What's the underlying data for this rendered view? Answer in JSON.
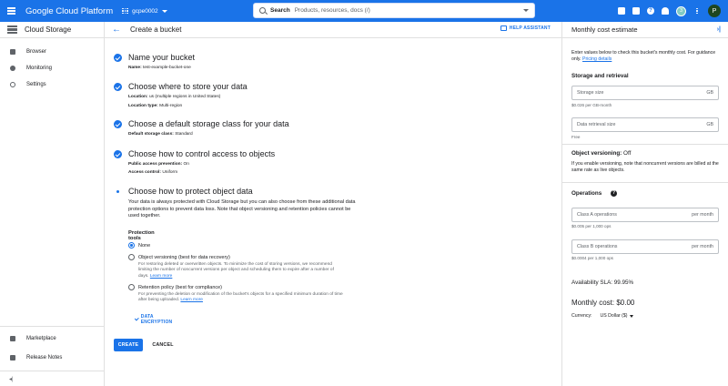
{
  "topbar": {
    "brand": "Google Cloud Platform",
    "project": "gcpe0002",
    "search_label": "Search",
    "search_placeholder": "Products, resources, docs (/)",
    "badge": "3",
    "avatar": "P",
    "bg_color": "#1a73e8"
  },
  "sidebar": {
    "title": "Cloud Storage",
    "items": [
      {
        "label": "Browser",
        "icon": "bucket-icon"
      },
      {
        "label": "Monitoring",
        "icon": "monitoring-icon"
      },
      {
        "label": "Settings",
        "icon": "gear-icon"
      }
    ],
    "bottom_items": [
      {
        "label": "Marketplace",
        "icon": "marketplace-icon"
      },
      {
        "label": "Release Notes",
        "icon": "notes-icon"
      }
    ],
    "collapse": "◂|"
  },
  "main": {
    "title": "Create a bucket",
    "help": "HELP ASSISTANT",
    "steps": {
      "name": {
        "title": "Name your bucket",
        "k1": "Name:",
        "v1": "test-example-bucket-one"
      },
      "location": {
        "title": "Choose where to store your data",
        "k1": "Location:",
        "v1": "us (multiple regions in United States)",
        "k2": "Location type:",
        "v2": "Multi-region"
      },
      "storage": {
        "title": "Choose a default storage class for your data",
        "k1": "Default storage class:",
        "v1": "Standard"
      },
      "access": {
        "title": "Choose how to control access to objects",
        "k1": "Public access prevention:",
        "v1": "On",
        "k2": "Access control:",
        "v2": "Uniform"
      },
      "protect": {
        "title": "Choose how to protect object data",
        "desc": "Your data is always protected with Cloud Storage but you can also choose from these additional data protection options to prevent data loss. Note that object versioning and retention policies cannot be used together.",
        "tools_title": "Protection tools",
        "opt_none": "None",
        "opt_versioning": "Object versioning (best for data recovery)",
        "opt_versioning_desc": "For restoring deleted or overwritten objects. To minimize the cost of storing versions, we recommend limiting the number of noncurrent versions per object and scheduling them to expire after a number of days.",
        "opt_retention": "Retention policy (best for compliance)",
        "opt_retention_desc": "For preventing the deletion or modification of the bucket's objects for a specified minimum duration of time after being uploaded.",
        "learn_more": "Learn more",
        "encryption": "DATA ENCRYPTION"
      }
    },
    "create": "CREATE",
    "cancel": "CANCEL"
  },
  "cost_panel": {
    "title": "Monthly cost estimate",
    "intro": "Enter values below to check this bucket's monthly cost. For guidance only.",
    "pricing": "Pricing details",
    "storage_title": "Storage and retrieval",
    "storage_size": {
      "label": "Storage size",
      "unit": "GB",
      "hint": "$0.026 per GB-month"
    },
    "retrieval_size": {
      "label": "Data retrieval size",
      "unit": "GB",
      "hint": "Free"
    },
    "versioning_title": "Object versioning:",
    "versioning_value": "Off",
    "versioning_text": "If you enable versioning, note that noncurrent versions are billed at the same rate as live objects.",
    "operations_title": "Operations",
    "class_a": {
      "label": "Class A operations",
      "unit": "per month",
      "hint": "$0.005 per 1,000 ops"
    },
    "class_b": {
      "label": "Class B operations",
      "unit": "per month",
      "hint": "$0.0004 per 1,000 ops"
    },
    "sla": "Availability SLA: 99.95%",
    "monthly": "Monthly cost: $0.00",
    "currency_label": "Currency:",
    "currency_value": "US Dollar ($)"
  }
}
